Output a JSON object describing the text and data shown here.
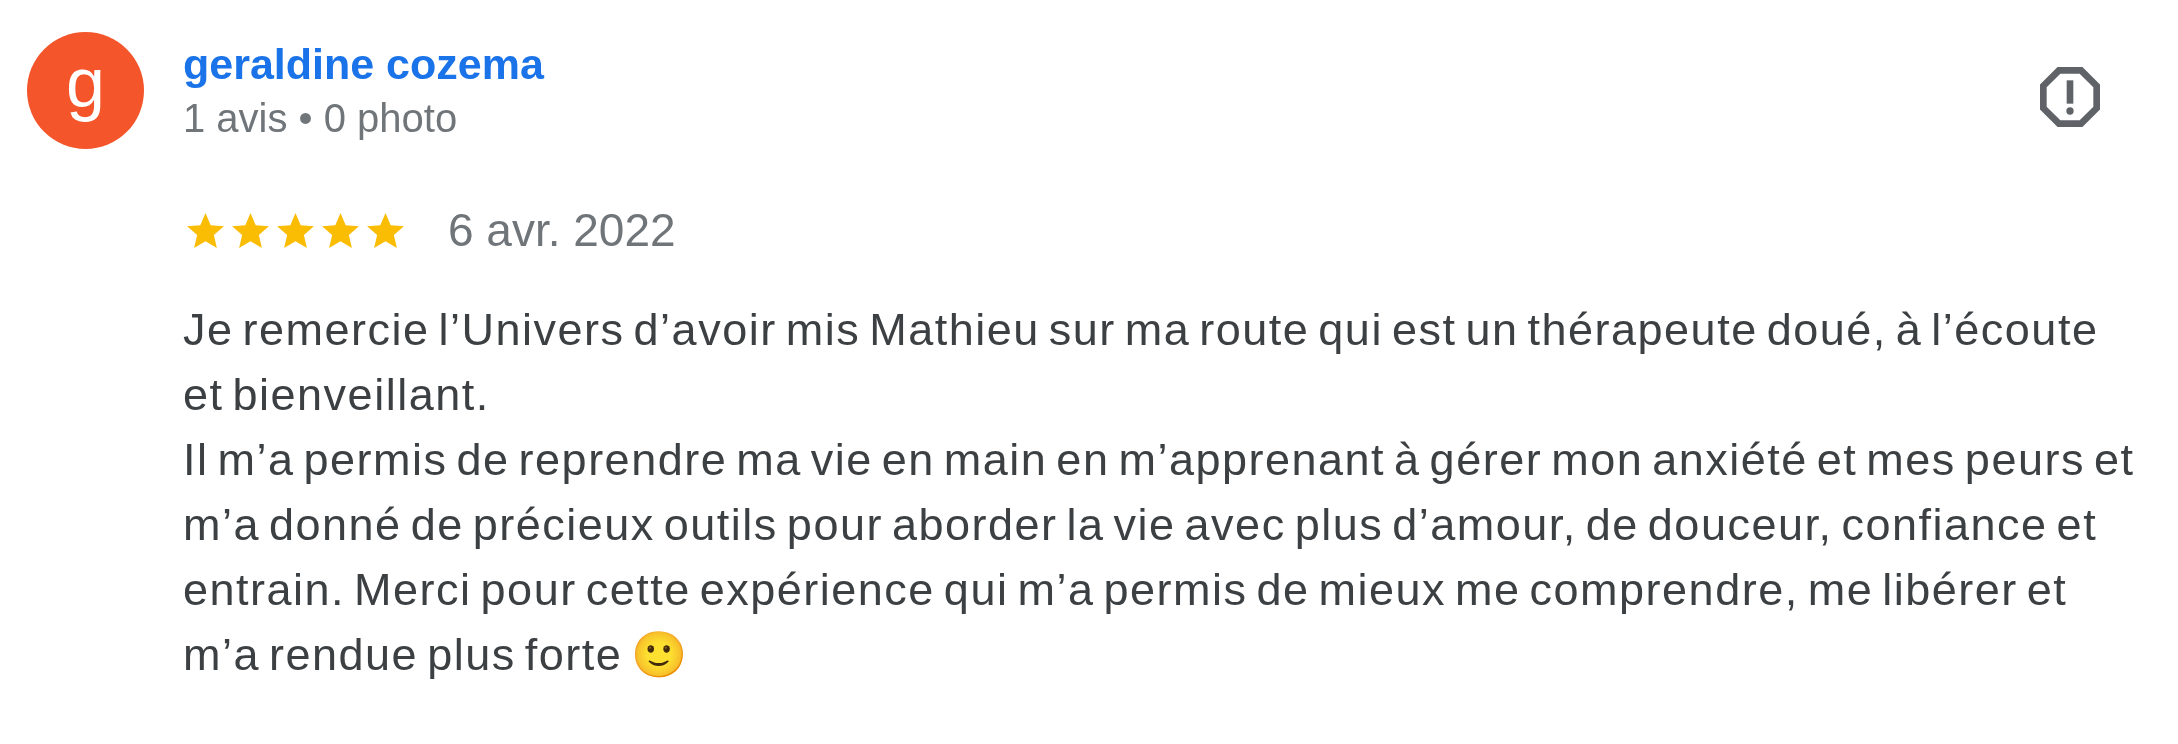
{
  "review": {
    "author": {
      "initial": "g",
      "name": "geraldine cozema",
      "meta": "1 avis • 0 photo"
    },
    "stars": 5,
    "date": "6 avr. 2022",
    "paragraphs": [
      "Je remercie l’Univers d’avoir mis Mathieu sur ma route qui est un thérapeute doué, à l’écoute et bienveillant.",
      "Il m’a permis de reprendre ma vie en main en m’apprenant à gérer mon anxiété et mes peurs et m’a donné de précieux outils pour aborder la vie avec plus d’amour, de douceur, confiance et entrain. Merci pour cette expérience qui m’a permis de mieux me comprendre, me libérer et m’a rendue plus forte 🙂"
    ]
  }
}
